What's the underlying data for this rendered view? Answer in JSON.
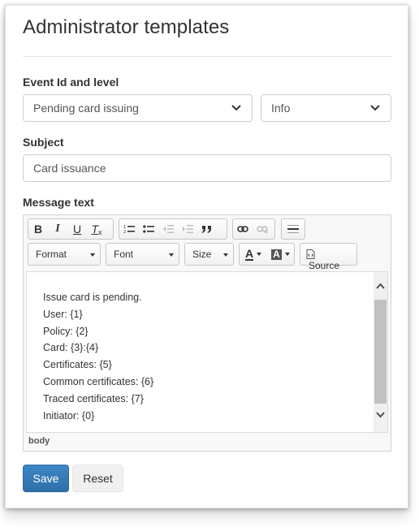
{
  "page": {
    "title": "Administrator templates"
  },
  "event": {
    "label": "Event Id and level",
    "event_value": "Pending card issuing",
    "level_value": "Info"
  },
  "subject": {
    "label": "Subject",
    "value": "Card issuance"
  },
  "message": {
    "label": "Message text",
    "toolbar": {
      "bold": "B",
      "italic": "I",
      "underline": "U",
      "clear_format": "T",
      "format": "Format",
      "font": "Font",
      "size": "Size",
      "text_color": "A",
      "bg_color": "A",
      "source": "Source"
    },
    "lines": [
      "Issue card is pending.",
      "User: {1}",
      "Policy: {2}",
      "Card: {3}:{4}",
      "Certificates: {5}",
      "Common certificates: {6}",
      "Traced certificates: {7}",
      "Initiator: {0}"
    ],
    "path": "body"
  },
  "actions": {
    "save": "Save",
    "reset": "Reset"
  },
  "colors": {
    "primary": "#337ab7",
    "border": "#cccccc"
  }
}
